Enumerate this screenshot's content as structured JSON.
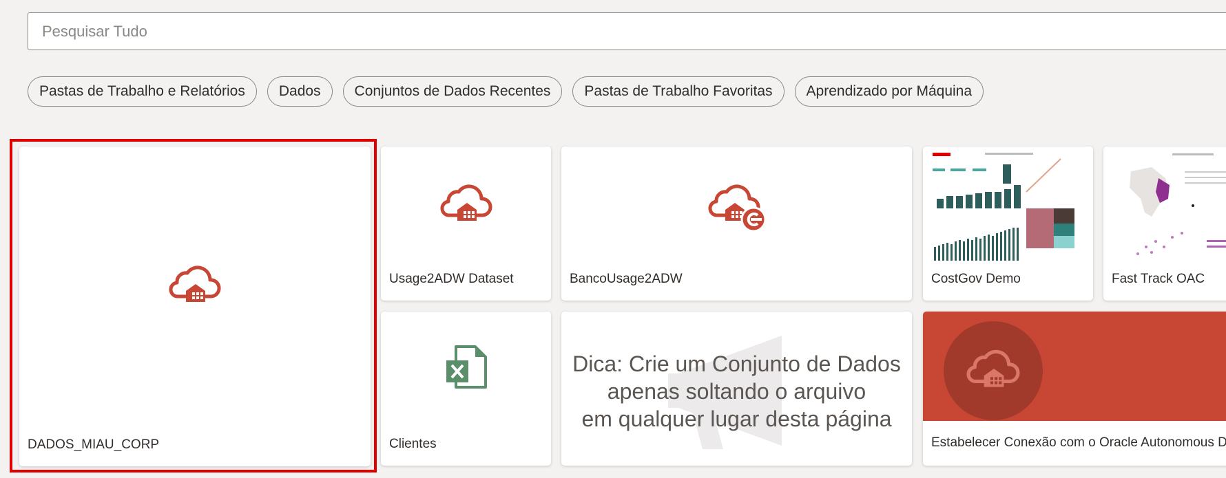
{
  "search": {
    "placeholder": "Pesquisar Tudo",
    "value": ""
  },
  "filters": [
    {
      "label": "Pastas de Trabalho e Relatórios"
    },
    {
      "label": "Dados"
    },
    {
      "label": "Conjuntos de Dados Recentes"
    },
    {
      "label": "Pastas de Trabalho Favoritas"
    },
    {
      "label": "Aprendizado por Máquina"
    }
  ],
  "cards": {
    "dados_miau": {
      "label": "DADOS_MIAU_CORP",
      "icon": "cloud-warehouse-icon",
      "selected": true
    },
    "usage2adw": {
      "label": "Usage2ADW Dataset",
      "icon": "cloud-warehouse-icon"
    },
    "bancousage": {
      "label": "BancoUsage2ADW",
      "icon": "cloud-warehouse-connection-icon"
    },
    "costgov": {
      "label": "CostGov Demo",
      "icon": "dashboard-thumbnail"
    },
    "fasttrack": {
      "label": "Fast Track OAC",
      "icon": "dashboard-thumbnail"
    },
    "clientes": {
      "label": "Clientes",
      "icon": "excel-file-icon"
    },
    "tip": {
      "lines": [
        "Dica: Crie um Conjunto de Dados",
        "apenas soltando o arquivo",
        "em qualquer lugar desta página"
      ],
      "icon": "megaphone-icon"
    },
    "connect": {
      "label": "Estabelecer Conexão com o Oracle Autonomous Da",
      "icon": "cloud-warehouse-icon"
    }
  },
  "colors": {
    "accent": "#c74634",
    "excel": "#5b8f6b",
    "selection": "#e00000",
    "connect_bg": "#c74634"
  }
}
